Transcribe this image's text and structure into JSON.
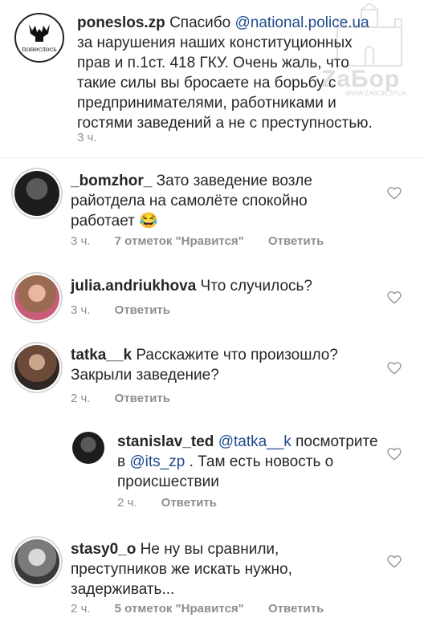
{
  "watermark": {
    "brand": "ZаБор",
    "site": "WWW.ZABOR.ZP.UA"
  },
  "comments": [
    {
      "username": "poneslos.zp",
      "avatar_label": "понеслось",
      "line1_pre": "Спасибо ",
      "mention": "@national.police.ua",
      "rest_lines": [
        "за нарушения наших конституционных",
        "прав и п.1ст. 418 ГКУ. Очень жаль, что",
        "такие силы вы бросаете на борьбу с",
        "предпринимателями, работниками и",
        "гостями заведений а не с преступностью."
      ],
      "time": "3 ч."
    },
    {
      "username": "_bomzhor_",
      "line1": "Зато заведение возле",
      "lines": [
        "райотдела на самолёте спокойно",
        "работает 😂"
      ],
      "time": "3 ч.",
      "likes": "7 отметок \"Нравится\"",
      "reply": "Ответить"
    },
    {
      "username": "julia.andriukhova",
      "line1": "Что случилось?",
      "time": "3 ч.",
      "reply": "Ответить"
    },
    {
      "username": "tatka__k",
      "line1": "Расскажите что произошло?",
      "lines": [
        "Закрыли заведение?"
      ],
      "time": "2 ч.",
      "reply": "Ответить"
    },
    {
      "username": "stanislav_ted",
      "mention1": "@tatka__k",
      "line1_post": " посмотрите",
      "line2_pre": "в ",
      "mention2": "@its_zp",
      "line2_post": " . Там есть новость о",
      "line3": "происшествии",
      "time": "2 ч.",
      "reply": "Ответить"
    },
    {
      "username": "stasy0_o",
      "line1": "Не ну вы сравнили,",
      "lines": [
        "преступников же искать нужно,",
        "задерживать..."
      ],
      "time": "2 ч.",
      "likes": "5 отметок \"Нравится\"",
      "reply": "Ответить"
    }
  ],
  "colors": {
    "mention": "#1f4b8e",
    "meta": "#8e8e8e",
    "text": "#262626"
  }
}
